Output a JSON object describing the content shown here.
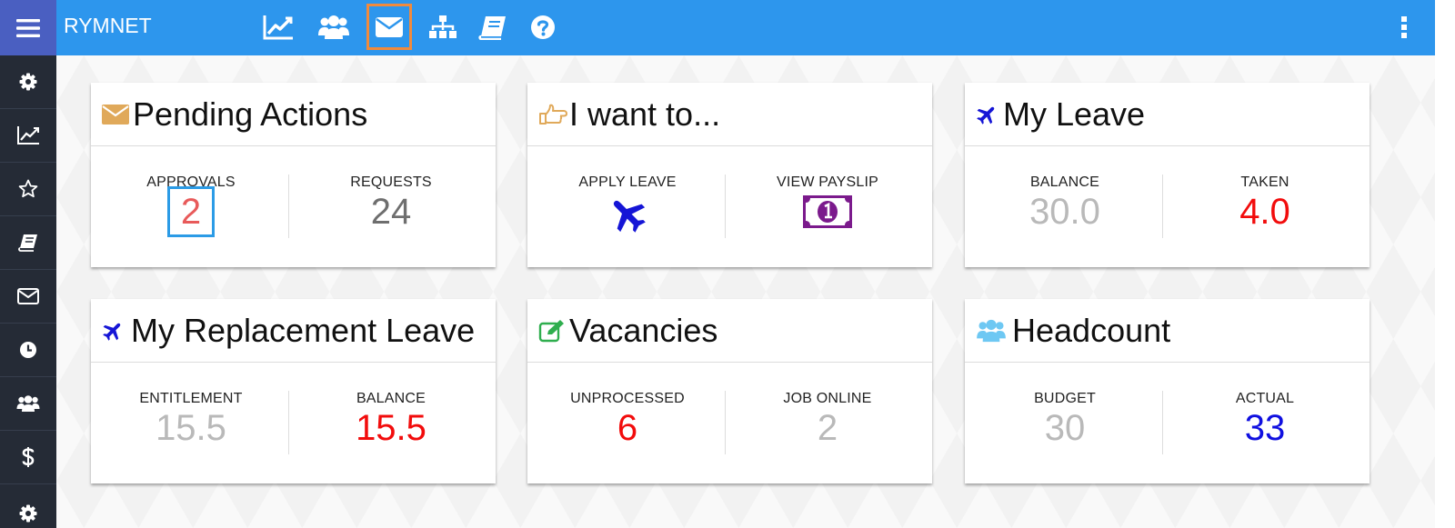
{
  "app": {
    "title": "RYMNET"
  },
  "topnav": {
    "items": [
      {
        "id": "analytics",
        "icon": "chart-line-icon"
      },
      {
        "id": "people",
        "icon": "users-icon"
      },
      {
        "id": "inbox",
        "icon": "envelope-icon",
        "active": true
      },
      {
        "id": "org-chart",
        "icon": "sitemap-icon"
      },
      {
        "id": "handbook",
        "icon": "book-icon"
      },
      {
        "id": "help",
        "icon": "question-circle-icon"
      }
    ],
    "more_icon": "vertical-dots-icon"
  },
  "sidebar": {
    "items": [
      {
        "id": "settings",
        "icon": "gear-icon"
      },
      {
        "id": "analytics",
        "icon": "chart-line-icon"
      },
      {
        "id": "favorites",
        "icon": "star-icon"
      },
      {
        "id": "handbook",
        "icon": "book-icon"
      },
      {
        "id": "inbox",
        "icon": "envelope-icon"
      },
      {
        "id": "history",
        "icon": "clock-icon"
      },
      {
        "id": "people",
        "icon": "users-icon"
      },
      {
        "id": "payroll",
        "icon": "dollar-icon"
      },
      {
        "id": "more-settings",
        "icon": "gear-icon"
      }
    ]
  },
  "cards": {
    "pending_actions": {
      "title": "Pending Actions",
      "icon": "envelope-icon",
      "left": {
        "label": "APPROVALS",
        "value": "2"
      },
      "right": {
        "label": "REQUESTS",
        "value": "24"
      }
    },
    "i_want_to": {
      "title": "I want to...",
      "icon": "hand-point-right-icon",
      "left": {
        "label": "APPLY LEAVE",
        "icon": "plane-icon"
      },
      "right": {
        "label": "VIEW PAYSLIP",
        "icon": "money-bill-icon"
      }
    },
    "my_leave": {
      "title": "My Leave",
      "icon": "plane-icon",
      "left": {
        "label": "BALANCE",
        "value": "30.0"
      },
      "right": {
        "label": "TAKEN",
        "value": "4.0"
      }
    },
    "my_replacement_leave": {
      "title": "My Replacement Leave",
      "icon": "plane-icon",
      "left": {
        "label": "ENTITLEMENT",
        "value": "15.5"
      },
      "right": {
        "label": "BALANCE",
        "value": "15.5"
      }
    },
    "vacancies": {
      "title": "Vacancies",
      "icon": "edit-icon",
      "left": {
        "label": "UNPROCESSED",
        "value": "6"
      },
      "right": {
        "label": "JOB ONLINE",
        "value": "2"
      }
    },
    "headcount": {
      "title": "Headcount",
      "icon": "users-icon",
      "left": {
        "label": "BUDGET",
        "value": "30"
      },
      "right": {
        "label": "ACTUAL",
        "value": "33"
      }
    }
  },
  "colors": {
    "topbar": "#2d96ed",
    "hamburger_bg": "#4a5fc1",
    "sidebar": "#252b36",
    "active_nav_outline": "#f18a3c",
    "highlight_box": "#2b9be6",
    "value_red": "#f20c0c",
    "value_grey": "#b9b9b9",
    "value_darkgrey": "#6e6e6e",
    "value_blue": "#1010e0",
    "payslip_purple": "#7b1a8c",
    "plane_blue": "#1515d6"
  }
}
